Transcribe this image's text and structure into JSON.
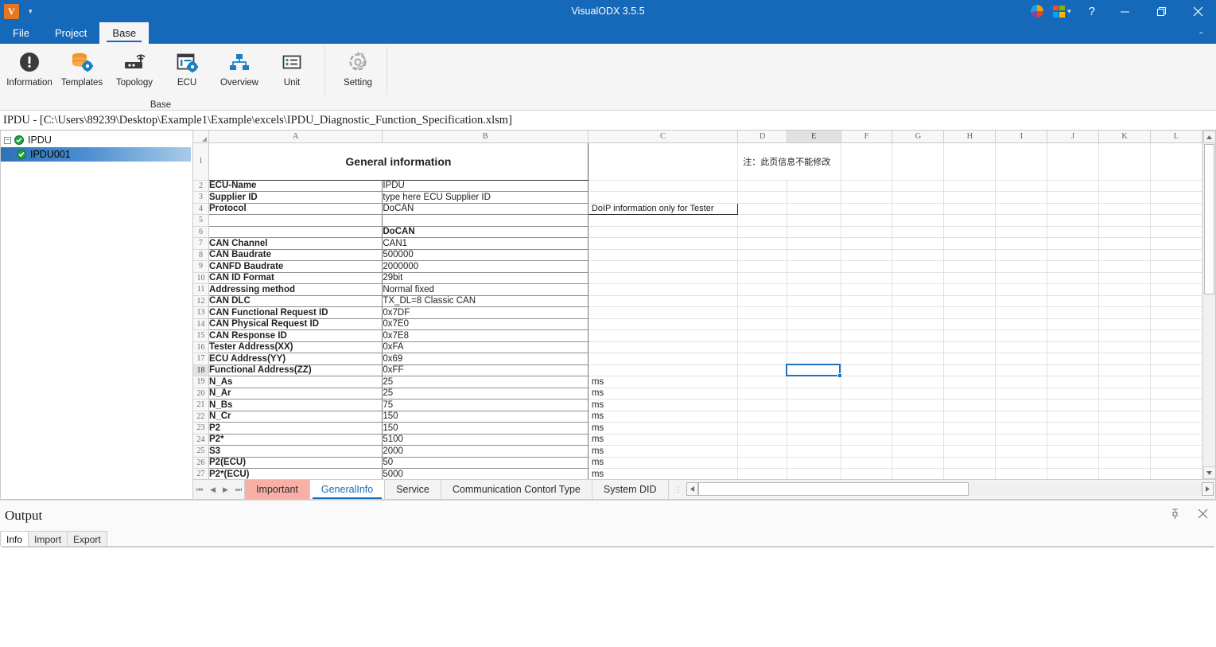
{
  "window": {
    "title": "VisualODX 3.5.5",
    "logo_text": "V",
    "qat_caret": "▾",
    "help_label": "?",
    "minimize_label": "Minimize",
    "restore_label": "Restore",
    "close_label": "Close",
    "collapse_ribbon": "⌃"
  },
  "ribbon": {
    "tabs": [
      {
        "label": "File",
        "active": false
      },
      {
        "label": "Project",
        "active": false
      },
      {
        "label": "Base",
        "active": true
      }
    ],
    "groups": [
      {
        "name": "Base",
        "label": "Base",
        "buttons": [
          {
            "label": "Information",
            "icon": "information-icon"
          },
          {
            "label": "Templates",
            "icon": "templates-icon"
          },
          {
            "label": "Topology",
            "icon": "topology-icon"
          },
          {
            "label": "ECU",
            "icon": "ecu-icon"
          },
          {
            "label": "Overview",
            "icon": "overview-icon"
          },
          {
            "label": "Unit",
            "icon": "unit-icon"
          }
        ]
      },
      {
        "name": "Settings",
        "label": "",
        "buttons": [
          {
            "label": "Setting",
            "icon": "gear-icon"
          }
        ]
      }
    ]
  },
  "document": {
    "path_caption": "IPDU - [C:\\Users\\89239\\Desktop\\Example1\\Example\\excels\\IPDU_Diagnostic_Function_Specification.xlsm]"
  },
  "tree": {
    "root": {
      "label": "IPDU",
      "expander": "−",
      "status": "ok"
    },
    "children": [
      {
        "label": "IPDU001",
        "status": "ok",
        "selected": true
      }
    ]
  },
  "sheet": {
    "columns": [
      "A",
      "B",
      "C",
      "D",
      "E",
      "F",
      "G",
      "H",
      "I",
      "J",
      "K",
      "L"
    ],
    "selected_column": "E",
    "selected_row": 18,
    "selected_cell": "E18",
    "title_row": {
      "row": 1,
      "text": "General information"
    },
    "note": {
      "row": 1,
      "column": "D",
      "text": "注：此页信息不能修改"
    },
    "callout": {
      "row": 4,
      "column": "C",
      "text": "DoIP information only for Tester"
    },
    "rows": [
      {
        "n": 2,
        "a": "ECU-Name",
        "b": "IPDU",
        "c": ""
      },
      {
        "n": 3,
        "a": "Supplier ID",
        "b": "type here ECU Supplier ID",
        "c": ""
      },
      {
        "n": 4,
        "a": "Protocol",
        "b": "DoCAN",
        "c": ""
      },
      {
        "n": 5,
        "a": "",
        "b": "",
        "c": ""
      },
      {
        "n": 6,
        "a": "",
        "b": "DoCAN",
        "c": ""
      },
      {
        "n": 7,
        "a": "CAN Channel",
        "b": "CAN1",
        "c": ""
      },
      {
        "n": 8,
        "a": "CAN Baudrate",
        "b": "500000",
        "c": ""
      },
      {
        "n": 9,
        "a": "CANFD Baudrate",
        "b": "2000000",
        "c": ""
      },
      {
        "n": 10,
        "a": "CAN ID Format",
        "b": "29bit",
        "c": ""
      },
      {
        "n": 11,
        "a": "Addressing method",
        "b": "Normal fixed",
        "c": ""
      },
      {
        "n": 12,
        "a": "CAN DLC",
        "b": "TX_DL=8 Classic CAN",
        "c": ""
      },
      {
        "n": 13,
        "a": "CAN Functional Request ID",
        "b": "0x7DF",
        "c": ""
      },
      {
        "n": 14,
        "a": "CAN Physical Request ID",
        "b": "0x7E0",
        "c": ""
      },
      {
        "n": 15,
        "a": "CAN Response ID",
        "b": "0x7E8",
        "c": ""
      },
      {
        "n": 16,
        "a": "Tester Address(XX)",
        "b": "0xFA",
        "c": ""
      },
      {
        "n": 17,
        "a": "ECU Address(YY)",
        "b": "0x69",
        "c": ""
      },
      {
        "n": 18,
        "a": "Functional Address(ZZ)",
        "b": "0xFF",
        "c": ""
      },
      {
        "n": 19,
        "a": "N_As",
        "b": "25",
        "c": "ms"
      },
      {
        "n": 20,
        "a": "N_Ar",
        "b": "25",
        "c": "ms"
      },
      {
        "n": 21,
        "a": "N_Bs",
        "b": "75",
        "c": "ms"
      },
      {
        "n": 22,
        "a": "N_Cr",
        "b": "150",
        "c": "ms"
      },
      {
        "n": 23,
        "a": "P2",
        "b": "150",
        "c": "ms"
      },
      {
        "n": 24,
        "a": "P2*",
        "b": "5100",
        "c": "ms"
      },
      {
        "n": 25,
        "a": "S3",
        "b": "2000",
        "c": "ms"
      },
      {
        "n": 26,
        "a": "P2(ECU)",
        "b": "50",
        "c": "ms"
      },
      {
        "n": 27,
        "a": "P2*(ECU)",
        "b": "5000",
        "c": "ms"
      }
    ],
    "nav_buttons": [
      "⏮",
      "◀",
      "▶",
      "⏭"
    ],
    "tabs": [
      {
        "label": "Important",
        "state": "important"
      },
      {
        "label": "GeneralInfo",
        "state": "active"
      },
      {
        "label": "Service",
        "state": "normal"
      },
      {
        "label": "Communication Contorl Type",
        "state": "normal"
      },
      {
        "label": "System DID",
        "state": "normal"
      }
    ]
  },
  "output": {
    "title": "Output",
    "pin_icon": "pin-icon",
    "close_icon": "close-icon",
    "tabs": [
      {
        "label": "Info",
        "active": true
      },
      {
        "label": "Import",
        "active": false
      },
      {
        "label": "Export",
        "active": false
      }
    ],
    "body_text": ""
  },
  "colors": {
    "accent": "#1668b8",
    "important_tab": "#f8afa6",
    "ok_green": "#21a040",
    "selection_blue": "#1f6fc4"
  }
}
